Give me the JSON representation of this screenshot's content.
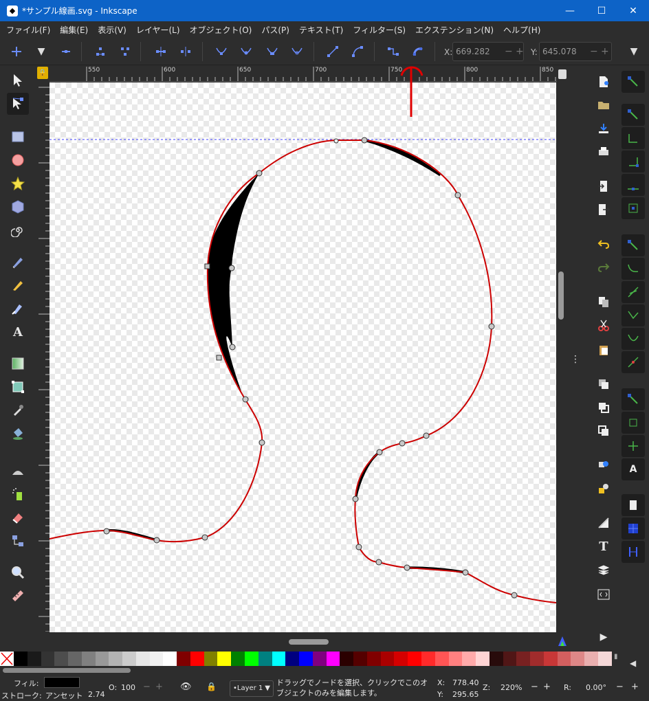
{
  "window": {
    "title": "*サンプル線画.svg - Inkscape",
    "minimize": "—",
    "maximize": "☐",
    "close": "✕"
  },
  "menu": [
    "ファイル(F)",
    "編集(E)",
    "表示(V)",
    "レイヤー(L)",
    "オブジェクト(O)",
    "パス(P)",
    "テキスト(T)",
    "フィルター(S)",
    "エクステンション(N)",
    "ヘルプ(H)"
  ],
  "toolbar": {
    "x_label": "X:",
    "x_value": "669.282",
    "y_label": "Y:",
    "y_value": "645.078",
    "minus": "−",
    "plus": "+"
  },
  "ruler": {
    "top_labels": [
      "550",
      "600",
      "650",
      "700",
      "750",
      "800",
      "850"
    ]
  },
  "status": {
    "fill_label": "フィル:",
    "stroke_label": "ストローク:",
    "stroke_value": "アンセット",
    "stroke_width": "2.74",
    "opacity_label": "O:",
    "opacity_value": "100",
    "layer": "•Layer 1",
    "message": "ドラッグでノードを選択、クリックでこのオブジェクトのみを編集します。",
    "cursor_x_label": "X:",
    "cursor_x": "778.40",
    "cursor_y_label": "Y:",
    "cursor_y": "295.65",
    "zoom_label": "Z:",
    "zoom": "220%",
    "rotate_label": "R:",
    "rotate": "0.00°"
  },
  "colors": {
    "accent": "#0d63c7",
    "path_stroke": "#cc0000",
    "annotation": "#e00000"
  },
  "palette": [
    "#000000",
    "#1a1a1a",
    "#333333",
    "#4d4d4d",
    "#666666",
    "#808080",
    "#999999",
    "#b3b3b3",
    "#cccccc",
    "#e6e6e6",
    "#f2f2f2",
    "#ffffff",
    "#800000",
    "#ff0000",
    "#808000",
    "#ffff00",
    "#008000",
    "#00ff00",
    "#008080",
    "#00ffff",
    "#000080",
    "#0000ff",
    "#800080",
    "#ff00ff",
    "#2b0000",
    "#550000",
    "#800000",
    "#aa0000",
    "#d40000",
    "#ff0000",
    "#ff2a2a",
    "#ff5555",
    "#ff8080",
    "#ffaaaa",
    "#ffd5d5",
    "#280b0b",
    "#501616",
    "#782121",
    "#a02c2c",
    "#c83737",
    "#d35f5f",
    "#de8787",
    "#e9afaf",
    "#f4d7d7"
  ]
}
